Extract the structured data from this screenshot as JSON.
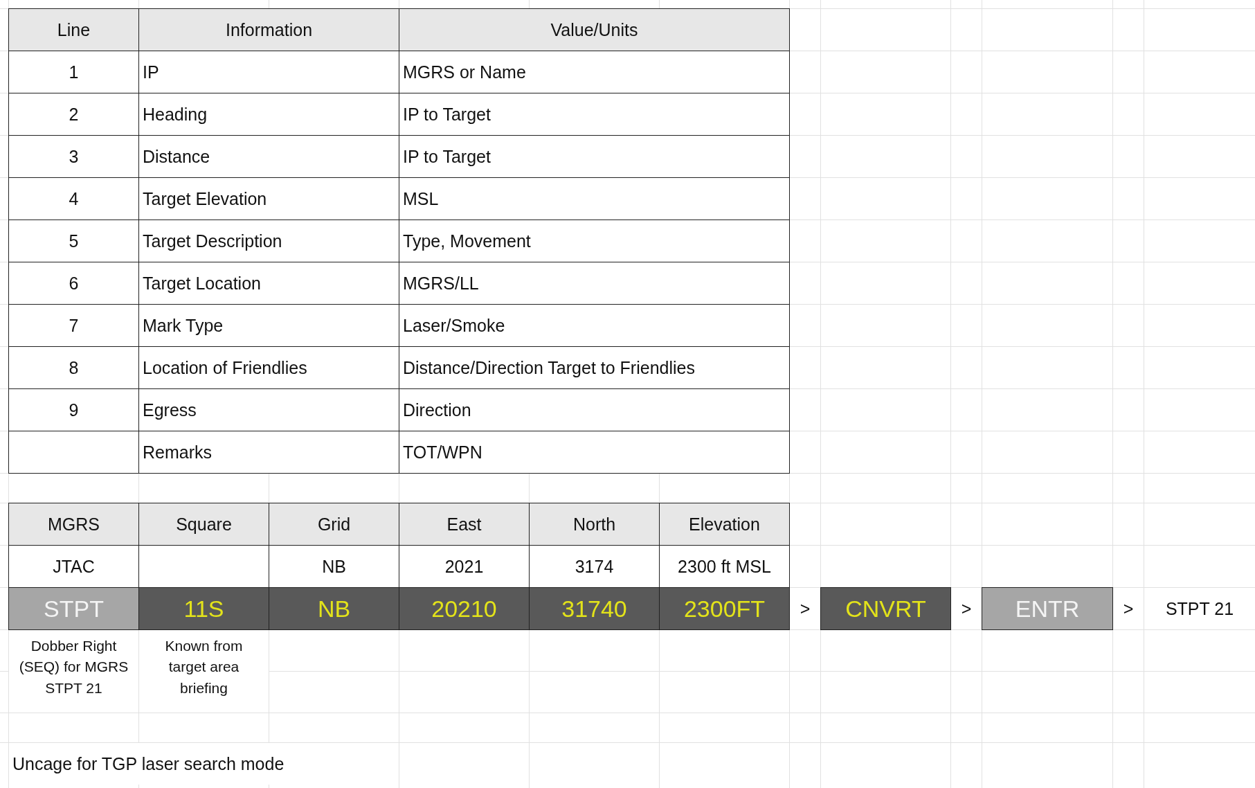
{
  "briefing_table": {
    "columns": [
      "Line",
      "Information",
      "Value/Units"
    ],
    "rows": [
      {
        "line": "1",
        "information": "IP",
        "value": "MGRS or Name"
      },
      {
        "line": "2",
        "information": "Heading",
        "value": "IP to Target"
      },
      {
        "line": "3",
        "information": "Distance",
        "value": "IP to Target"
      },
      {
        "line": "4",
        "information": "Target Elevation",
        "value": "MSL"
      },
      {
        "line": "5",
        "information": "Target Description",
        "value": "Type, Movement"
      },
      {
        "line": "6",
        "information": "Target Location",
        "value": "MGRS/LL"
      },
      {
        "line": "7",
        "information": "Mark Type",
        "value": "Laser/Smoke"
      },
      {
        "line": "8",
        "information": "Location of Friendlies",
        "value": "Distance/Direction Target to Friendlies"
      },
      {
        "line": "9",
        "information": "Egress",
        "value": "Direction"
      },
      {
        "information": "Remarks",
        "value": "TOT/WPN"
      }
    ]
  },
  "mgrs_table": {
    "columns": [
      "MGRS",
      "Square",
      "Grid",
      "East",
      "North",
      "Elevation"
    ],
    "rows": [
      [
        "JTAC",
        null,
        "NB",
        "2021",
        "3174",
        "2300 ft MSL"
      ]
    ]
  },
  "entry_sequence": [
    {
      "kind": "light-key",
      "label": "STPT"
    },
    {
      "kind": "dark-key",
      "label": "11S"
    },
    {
      "kind": "dark-key",
      "label": "NB"
    },
    {
      "kind": "dark-key",
      "label": "20210"
    },
    {
      "kind": "dark-key",
      "label": "31740"
    },
    {
      "kind": "dark-key",
      "label": "2300FT"
    },
    {
      "kind": "arrow",
      "label": ">"
    },
    {
      "kind": "dark-key",
      "label": "CNVRT"
    },
    {
      "kind": "arrow",
      "label": ">"
    },
    {
      "kind": "light-key",
      "label": "ENTR"
    },
    {
      "kind": "arrow",
      "label": ">"
    },
    {
      "kind": "text",
      "label": "STPT 21"
    }
  ],
  "notes": [
    "Dobber Right (SEQ) for MGRS STPT 21",
    "Known from target area briefing"
  ],
  "remark": "Uncage for TGP laser search mode"
}
